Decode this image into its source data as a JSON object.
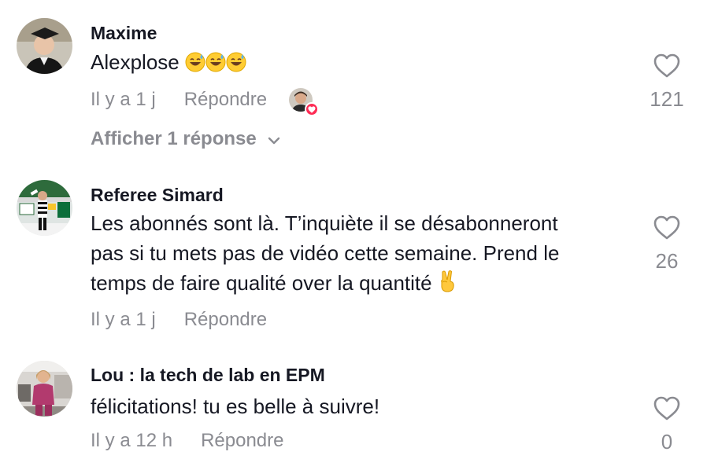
{
  "comments": [
    {
      "author": "Maxime",
      "text": "Alexplose",
      "emojis": [
        "sweat-smile-emoji",
        "sweat-smile-emoji",
        "sweat-smile-emoji"
      ],
      "time": "Il y a 1 j",
      "reply_label": "Répondre",
      "likes": "121",
      "view_replies": "Afficher 1 réponse",
      "liked_by_creator": true
    },
    {
      "author": "Referee Simard",
      "text_lines": [
        "Les abonnés sont là. T’inquiète il se désabonneront",
        "pas si tu mets pas de vidéo cette semaine. Prend le",
        "temps de faire qualité over la quantité"
      ],
      "emoji": "victory-hand-emoji",
      "time": "Il y a 1 j",
      "reply_label": "Répondre",
      "likes": "26"
    },
    {
      "author": "Lou : la tech de lab en EPM",
      "text": "félicitations! tu es belle à suivre!",
      "time": "Il y a 12 h",
      "reply_label": "Répondre",
      "likes": "0"
    }
  ],
  "colors": {
    "text_primary": "#161823",
    "text_secondary": "#8a8b91",
    "heart_outline": "#8a8b91",
    "creator_like_badge": "#fe2c55"
  }
}
